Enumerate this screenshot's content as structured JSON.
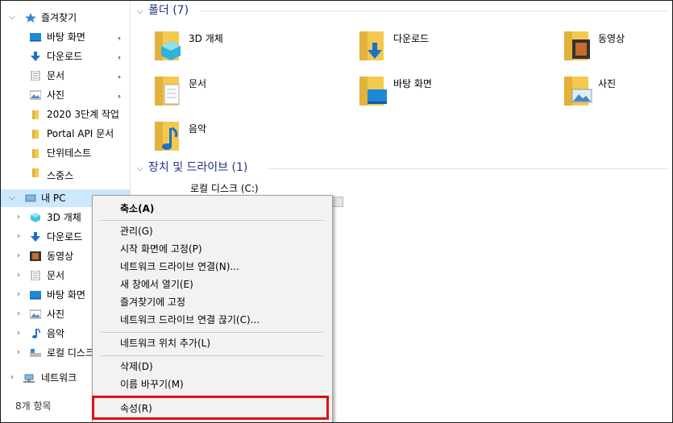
{
  "nav": {
    "quick_access": "즐겨찾기",
    "quick_items": [
      "바탕 화면",
      "다운로드",
      "문서",
      "사진",
      "2020 3단계 작업",
      "Portal API 문서",
      "단위테스트",
      "스중스"
    ],
    "this_pc": "내 PC",
    "pc_items": [
      "3D 개체",
      "다운로드",
      "동영상",
      "문서",
      "바탕 화면",
      "사진",
      "음악",
      "로컬 디스크 (C:)"
    ],
    "network": "네트워크"
  },
  "status": {
    "item_count": "8개 항목"
  },
  "main": {
    "folders_header": "폴더 (7)",
    "folders": [
      "3D 개체",
      "다운로드",
      "동영상",
      "문서",
      "바탕 화면",
      "사진",
      "음악"
    ],
    "drives_header": "장치 및 드라이브 (1)",
    "drive_name": "로컬 디스크 (C:)"
  },
  "context_menu": {
    "collapse": "축소(A)",
    "manage": "관리(G)",
    "pin_start": "시작 화면에 고정(P)",
    "map_drive": "네트워크 드라이브 연결(N)...",
    "open_new_window": "새 창에서 열기(E)",
    "pin_quick": "즐겨찾기에 고정",
    "disconnect_drive": "네트워크 드라이브 연결 끊기(C)...",
    "add_network_location": "네트워크 위치 추가(L)",
    "delete": "삭제(D)",
    "rename": "이름 바꾸기(M)",
    "properties": "속성(R)"
  },
  "colors": {
    "highlight_box": "#e01010",
    "group_header": "#1e3287",
    "folder": "#f3c94e",
    "accent": "#2b8ad8"
  }
}
